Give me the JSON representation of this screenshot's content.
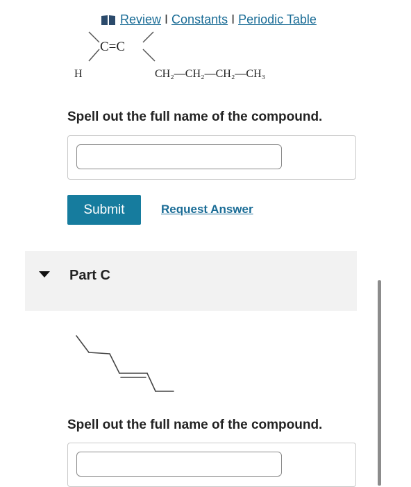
{
  "toplinks": {
    "icon": "book-icon",
    "review": "Review",
    "separator": "I",
    "constants": "Constants",
    "periodic_table": "Periodic Table"
  },
  "structure1": {
    "double_bond": "C=C",
    "h_label": "H",
    "chain_label": "CH₂—CH₂—CH₂—CH₃"
  },
  "part_b": {
    "prompt": "Spell out the full name of the compound.",
    "input_value": "",
    "submit_label": "Submit",
    "request_label": "Request Answer"
  },
  "part_c": {
    "caret_icon": "caret-down-icon",
    "label": "Part C",
    "prompt": "Spell out the full name of the compound.",
    "input_value": ""
  },
  "colors": {
    "link": "#1a6c96",
    "button": "#167c9e",
    "panel": "#f2f2f2"
  }
}
